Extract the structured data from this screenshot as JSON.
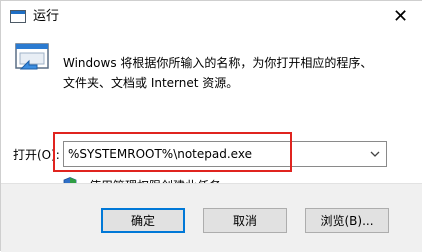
{
  "window": {
    "title": "运行",
    "close_glyph": "✕"
  },
  "description": {
    "line1": "Windows 将根据你所输入的名称，为你打开相应的程序、",
    "line2": "文件夹、文档或 Internet 资源。"
  },
  "open_field": {
    "label": "打开(O):",
    "value": "%SYSTEMROOT%\\notepad.exe"
  },
  "admin_note": "使用管理权限创建此任务。",
  "buttons": {
    "ok": "确定",
    "cancel": "取消",
    "browse": "浏览(B)..."
  },
  "icons": {
    "title": "run-window-icon",
    "run": "run-program-icon",
    "shield": "uac-shield-icon",
    "dropdown": "chevron-down-icon",
    "close": "close-icon"
  },
  "colors": {
    "highlight": "#e0241f",
    "accent": "#0078d7"
  }
}
